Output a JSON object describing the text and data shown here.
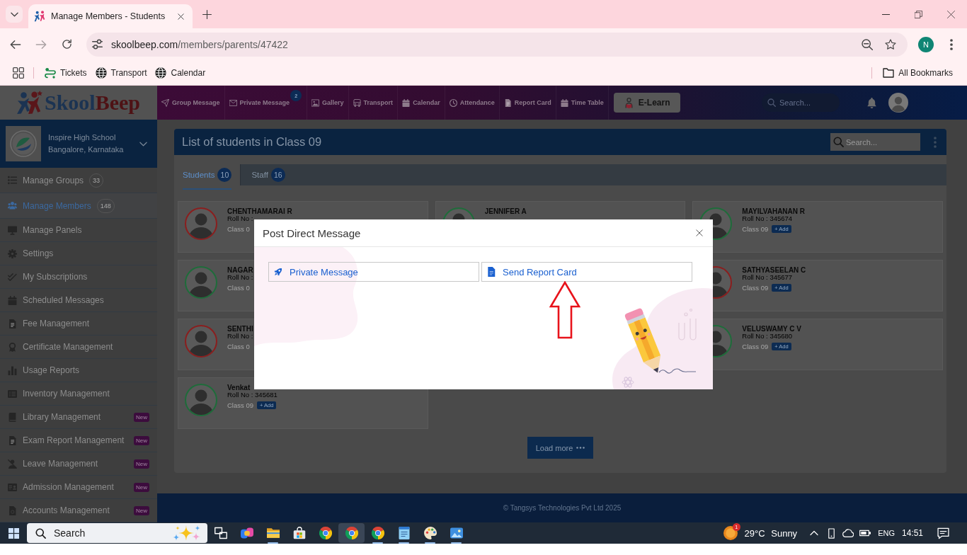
{
  "browser": {
    "tab": {
      "title": "Manage Members - Students",
      "selected": true
    },
    "url": {
      "host": "skoolbeep.com",
      "path": "/members/parents/47422"
    },
    "profile": "N",
    "bookmarks": [
      {
        "label": "Tickets",
        "kind": "tickets"
      },
      {
        "label": "Transport",
        "kind": "globe"
      },
      {
        "label": "Calendar",
        "kind": "globe"
      }
    ],
    "all_bookmarks": "All Bookmarks"
  },
  "header": {
    "logo": {
      "primary": "Skool",
      "accent": "Beep"
    },
    "nav": [
      {
        "label": "Group Message",
        "kind": "send"
      },
      {
        "label": "Private Message",
        "kind": "mail",
        "badge": "2"
      },
      {
        "label": "Gallery",
        "kind": "image"
      },
      {
        "label": "Transport",
        "kind": "bus"
      },
      {
        "label": "Calendar",
        "kind": "calendar"
      },
      {
        "label": "Attendance",
        "kind": "clock"
      },
      {
        "label": "Report Card",
        "kind": "file"
      },
      {
        "label": "Time Table",
        "kind": "calendar"
      }
    ],
    "elearn": "E-Learn",
    "search": {
      "placeholder": "Search..."
    }
  },
  "sidebar": {
    "school": {
      "name": "Inspire High School",
      "location": "Bangalore, Karnataka"
    },
    "items": [
      {
        "label": "Manage Groups",
        "kind": "list",
        "count": "33",
        "selected": false
      },
      {
        "label": "Manage Members",
        "kind": "users",
        "count": "148",
        "selected": true
      },
      {
        "label": "Manage Panels",
        "kind": "monitor",
        "selected": false
      },
      {
        "label": "Settings",
        "kind": "gear",
        "selected": false
      },
      {
        "label": "My Subscriptions",
        "kind": "check",
        "selected": false
      },
      {
        "label": "Scheduled Messages",
        "kind": "calendar",
        "selected": false
      },
      {
        "label": "Fee Management",
        "kind": "file",
        "selected": false
      },
      {
        "label": "Certificate Management",
        "kind": "award",
        "selected": false
      },
      {
        "label": "Usage Reports",
        "kind": "chart",
        "selected": false
      },
      {
        "label": "Inventory Management",
        "kind": "listbox",
        "selected": false
      },
      {
        "label": "Library Management",
        "kind": "book",
        "badge": "New",
        "selected": false
      },
      {
        "label": "Exam Report Management",
        "kind": "file",
        "badge": "New",
        "selected": false
      },
      {
        "label": "Leave Management",
        "kind": "person-slash",
        "badge": "New",
        "selected": false
      },
      {
        "label": "Admission Management",
        "kind": "idcard",
        "badge": "New",
        "selected": false
      },
      {
        "label": "Accounts Management",
        "kind": "file-coin",
        "badge": "New",
        "selected": false
      }
    ]
  },
  "content": {
    "title": "List of students in Class 09",
    "search": {
      "placeholder": "Search..."
    },
    "tabs": [
      {
        "label": "Students",
        "count": "10",
        "selected": true
      },
      {
        "label": "Staff",
        "count": "16",
        "selected": false
      }
    ],
    "columns": [
      [
        {
          "name": "CHENTHAMARAI R",
          "roll": "Roll No :",
          "class": "Class 0",
          "color": "#8a1e1e"
        },
        {
          "name": "NAGAR",
          "roll": "Roll No :",
          "class": "Class 0",
          "color": "#1e6c3a"
        },
        {
          "name": "SENTHI",
          "roll": "Roll No :",
          "class": "Class 0",
          "color": "#8a1e1e"
        },
        {
          "name": "Venkat",
          "roll": "Roll No : 345681",
          "class": "Class 09",
          "add": "+ Add",
          "color": "#1e6c3a"
        }
      ],
      [
        {
          "name": "JENNIFER A",
          "color": "#1e6c3a"
        }
      ],
      [
        {
          "name": "MAYILVAHANAN R",
          "roll": "Roll No : 345674",
          "class": "Class 09",
          "add": "+ Add",
          "color": "#1e6c3a"
        },
        {
          "name": "SATHYASEELAN C",
          "roll": "Roll No : 345677",
          "class": "Class 09",
          "add": "+ Add",
          "color": "#8a1e1e"
        },
        {
          "name": "VELUSWAMY C V",
          "roll": "Roll No : 345680",
          "class": "Class 09",
          "add": "+ Add",
          "color": "#1e6c3a"
        }
      ]
    ],
    "load_more": "Load more"
  },
  "footer": "© Tangsys Technologies Pvt Ltd 2025",
  "modal": {
    "title": "Post Direct Message",
    "options": [
      {
        "label": "Private Message",
        "kind": "rocket"
      },
      {
        "label": "Send Report Card",
        "kind": "file"
      }
    ]
  },
  "taskbar": {
    "search": {
      "placeholder": "Search"
    },
    "apps": [
      {
        "kind": "taskview",
        "selected": false,
        "running": false
      },
      {
        "kind": "copilot",
        "selected": false,
        "running": false
      },
      {
        "kind": "explorer",
        "selected": false,
        "running": true
      },
      {
        "kind": "store",
        "selected": false,
        "running": false
      },
      {
        "kind": "chrome",
        "selected": false,
        "running": false
      },
      {
        "kind": "chrome",
        "selected": true,
        "running": false
      },
      {
        "kind": "chrome",
        "selected": false,
        "running": true
      },
      {
        "kind": "notepad",
        "selected": false,
        "running": true
      },
      {
        "kind": "paint",
        "selected": false,
        "running": true
      },
      {
        "kind": "photos",
        "selected": false,
        "running": true
      }
    ],
    "weather": {
      "temperature": "29°C",
      "condition": "Sunny",
      "badge": "1"
    },
    "language": "ENG",
    "time": "14:51"
  }
}
